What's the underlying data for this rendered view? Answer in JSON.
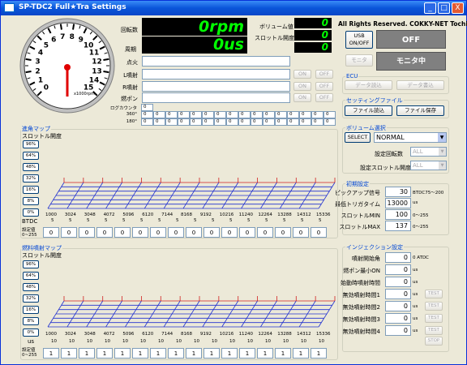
{
  "window": {
    "title": "SP-TDC2 Full★Tra Settings",
    "minimize": "_",
    "maximize": "□",
    "close": "X"
  },
  "gauge": {
    "ticks": [
      "0",
      "1",
      "2",
      "3",
      "4",
      "5",
      "6",
      "7",
      "8",
      "9",
      "10",
      "11",
      "12",
      "13",
      "14",
      "15"
    ],
    "unit": "x1000rpm"
  },
  "readouts": {
    "rpm_label": "回転数",
    "rpm_value": "0rpm",
    "period_label": "周期",
    "period_value": "0us",
    "volume_label": "ボリューム値",
    "volume_value": "0",
    "throttle_label": "スロットル開度",
    "throttle_value": "0",
    "third_value": "0"
  },
  "signals": [
    {
      "label": "点火",
      "btn1": "",
      "btn2": ""
    },
    {
      "label": "L噴射",
      "btn1": "ON",
      "btn2": "OFF"
    },
    {
      "label": "R噴射",
      "btn1": "ON",
      "btn2": "OFF"
    },
    {
      "label": "燃ポン",
      "btn1": "ON",
      "btn2": "OFF"
    }
  ],
  "log_rows": [
    {
      "label": "ログカウンタ",
      "values": [
        "0"
      ]
    },
    {
      "label": "360°",
      "values": [
        "0",
        "0",
        "0",
        "0",
        "0",
        "0",
        "0",
        "0",
        "0",
        "0",
        "0",
        "0",
        "0",
        "0",
        "0",
        "0"
      ]
    },
    {
      "label": "180°",
      "values": [
        "0",
        "0",
        "0",
        "0",
        "0",
        "0",
        "0",
        "0",
        "0",
        "0",
        "0",
        "0",
        "0",
        "0",
        "0",
        "0"
      ]
    }
  ],
  "copyright": "All Rights Reserved. COKKY-NET Tochin",
  "usb": {
    "button": "USB ON/OFF",
    "status": "OFF",
    "monitor_button": "モニタ",
    "monitor_status": "モニタ中"
  },
  "ecu": {
    "title": "ECU",
    "read": "データ読込",
    "write": "データ書込"
  },
  "setting_file": {
    "title": "セッティングファイル",
    "load": "ファイル読込",
    "save": "ファイル保存"
  },
  "volume_select": {
    "title": "ボリューム選択",
    "select_button": "SELECT",
    "mode": "NORMAL",
    "rpm_setting_label": "設定回転数",
    "rpm_setting_value": "ALL",
    "throttle_setting_label": "設定スロットル開度",
    "throttle_setting_value": "ALL"
  },
  "initial_settings": {
    "title": "初期設定",
    "rows": [
      {
        "label": "ピックアップ信号",
        "value": "30",
        "note": "BTDC75～200"
      },
      {
        "label": "最低トリガタイム",
        "value": "13000",
        "note": "us"
      },
      {
        "label": "スロットルMIN",
        "value": "100",
        "note": "0～255"
      },
      {
        "label": "スロットルMAX",
        "value": "137",
        "note": "0～255"
      }
    ]
  },
  "ignition_map": {
    "title": "進角マップ",
    "subtitle": "スロットル開度",
    "throttle_buttons": [
      "96%",
      "64%",
      "48%",
      "32%",
      "16%",
      "8%",
      "0%"
    ],
    "rpm_axis": [
      "1000",
      "3024",
      "3048",
      "4072",
      "5096",
      "6120",
      "7144",
      "8168",
      "9192",
      "10216",
      "11240",
      "12264",
      "13288",
      "14312",
      "15336"
    ],
    "btdc_label": "BTDC",
    "btdc_values": [
      "5",
      "5",
      "5",
      "5",
      "5",
      "5",
      "5",
      "5",
      "5",
      "5",
      "5",
      "5",
      "5",
      "5",
      "5",
      "5"
    ],
    "setting_label": "設定値\n0~255",
    "setting_values": [
      "0",
      "0",
      "0",
      "0",
      "0",
      "0",
      "0",
      "0",
      "0",
      "0",
      "0",
      "0",
      "0",
      "0",
      "0",
      "0"
    ]
  },
  "fuel_map": {
    "title": "燃料噴射マップ",
    "subtitle": "スロットル開度",
    "throttle_buttons": [
      "96%",
      "64%",
      "48%",
      "32%",
      "16%",
      "8%",
      "0%"
    ],
    "rpm_axis": [
      "1000",
      "3024",
      "3048",
      "4072",
      "5096",
      "6120",
      "7144",
      "8168",
      "9192",
      "10216",
      "11240",
      "12264",
      "13288",
      "14312",
      "15336"
    ],
    "us_label": "us",
    "us_values": [
      "10",
      "10",
      "10",
      "10",
      "10",
      "10",
      "10",
      "10",
      "10",
      "10",
      "10",
      "10",
      "10",
      "10",
      "10",
      "10"
    ],
    "setting_label": "設定値\n0~255",
    "setting_values": [
      "1",
      "1",
      "1",
      "1",
      "1",
      "1",
      "1",
      "1",
      "1",
      "1",
      "1",
      "1",
      "1",
      "1",
      "1",
      "1"
    ]
  },
  "injection": {
    "title": "インジェクション設定",
    "rows": [
      {
        "label": "噴射開始角",
        "value": "0",
        "unit": "0 ATDC",
        "test": ""
      },
      {
        "label": "燃ポン最小ON",
        "value": "0",
        "unit": "us",
        "test": ""
      },
      {
        "label": "始動時噴射時間",
        "value": "0",
        "unit": "us",
        "test": ""
      },
      {
        "label": "無効噴射時間1",
        "value": "0",
        "unit": "us",
        "test": "TEST"
      },
      {
        "label": "無効噴射時間2",
        "value": "0",
        "unit": "us",
        "test": "TEST"
      },
      {
        "label": "無効噴射時間3",
        "value": "0",
        "unit": "us",
        "test": "TEST"
      },
      {
        "label": "無効噴射時間4",
        "value": "0",
        "unit": "us",
        "test": "TEST"
      }
    ],
    "stop": "STOP"
  },
  "colors": {
    "lcd_bg": "#000000",
    "lcd_fg": "#00ff00",
    "group_title": "#0046d5",
    "grid_blue": "#2030d0",
    "grid_red": "#d02020",
    "needle": "#e00000"
  }
}
